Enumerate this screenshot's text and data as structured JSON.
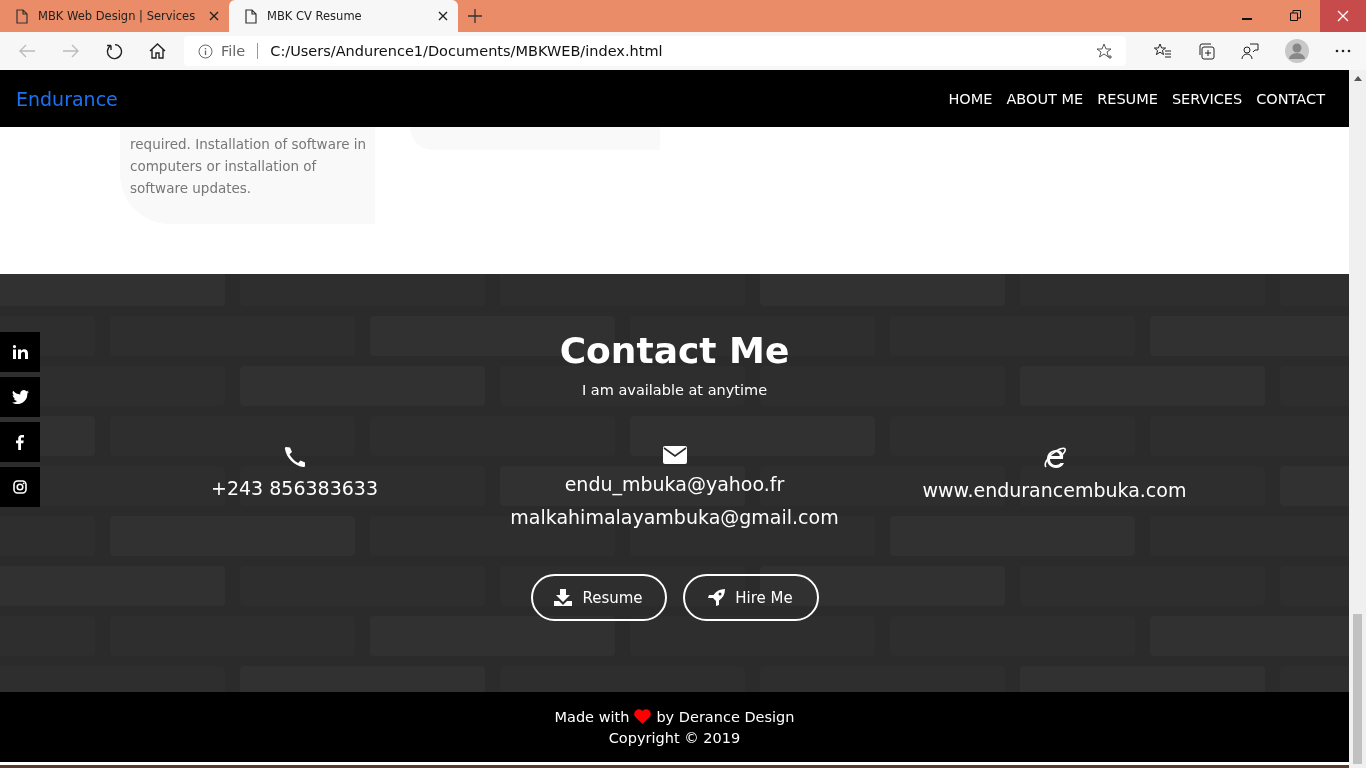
{
  "browser": {
    "tabs": [
      {
        "title": "MBK Web Design | Services",
        "selected": false
      },
      {
        "title": "MBK CV Resume",
        "selected": true
      }
    ],
    "address": {
      "scheme": "File",
      "url": "C:/Users/Andurence1/Documents/MBKWEB/index.html"
    }
  },
  "navbar": {
    "brand": "Endurance",
    "links": [
      {
        "label": "HOME"
      },
      {
        "label": "ABOUT ME"
      },
      {
        "label": "RESUME"
      },
      {
        "label": "SERVICES"
      },
      {
        "label": "CONTACT"
      }
    ]
  },
  "service_cards": [
    {
      "kind": "text",
      "text": "required. Installation of software in computers or installation of software updates."
    },
    {
      "kind": "blank"
    }
  ],
  "social": [
    {
      "kind": "linkedin"
    },
    {
      "kind": "twitter"
    },
    {
      "kind": "facebook"
    },
    {
      "kind": "instagram"
    }
  ],
  "contact": {
    "title": "Contact Me",
    "subtitle": "I am available at anytime",
    "items": [
      {
        "kind": "phone",
        "lines": [
          "+243 856383633"
        ]
      },
      {
        "kind": "email",
        "lines": [
          "endu_mbuka@yahoo.fr",
          "malkahimalayambuka@gmail.com"
        ]
      },
      {
        "kind": "web",
        "lines": [
          "www.endurancembuka.com"
        ]
      }
    ],
    "buttons": [
      {
        "kind": "download",
        "label": "Resume"
      },
      {
        "kind": "rocket",
        "label": "Hire Me"
      }
    ]
  },
  "footer": {
    "made_with": "Made with",
    "by": "by Derance Design",
    "copyright": "Copyright © 2019"
  }
}
